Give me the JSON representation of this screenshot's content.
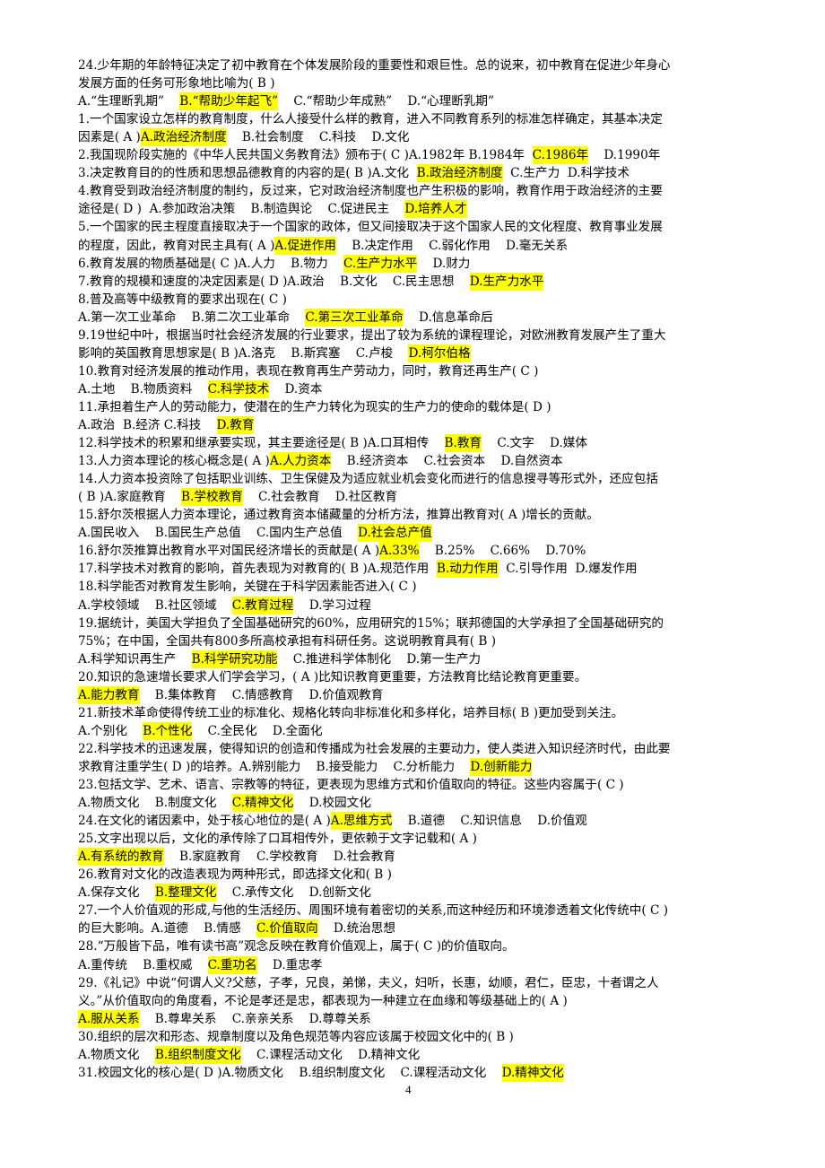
{
  "document": {
    "page_number": "4",
    "highlight_color": "#ffff00",
    "lines": [
      [
        {
          "t": "24.少年期的年龄特征决定了初中教育在个体发展阶段的重要性和艰巨性。总的说来，初中教育在促进少年身心"
        }
      ],
      [
        {
          "t": "发展方面的任务可形象地比喻为( B )"
        }
      ],
      [
        {
          "t": "A.“生理断乳期”    "
        },
        {
          "t": "B.“帮助少年起飞”",
          "h": true
        },
        {
          "t": "    C.“帮助少年成熟”    D.“心理断乳期”"
        }
      ],
      [
        {
          "t": "1.一个国家设立怎样的教育制度，什么人接受什么样的教育，进入不同教育系列的标准怎样确定，其基本决定"
        }
      ],
      [
        {
          "t": "因素是( A )"
        },
        {
          "t": "A.政治经济制度",
          "h": true
        },
        {
          "t": "    B.社会制度    C.科技    D.文化"
        }
      ],
      [
        {
          "t": "2.我国现阶段实施的《中华人民共国义务教育法》颁布于( C )A.1982年 B.1984年  "
        },
        {
          "t": "C.1986年",
          "h": true
        },
        {
          "t": "    D.1990年"
        }
      ],
      [
        {
          "t": "3.决定教育目的的性质和思想品德教育的内容的是( B )A.文化  "
        },
        {
          "t": "B.政治经济制度",
          "h": true
        },
        {
          "t": "  C.生产力  D.科学技术"
        }
      ],
      [
        {
          "t": "4.教育受到政治经济制度的制约，反过来，它对政治经济制度也产生积极的影响，教育作用于政治经济的主要"
        }
      ],
      [
        {
          "t": "途径是( D )  A.参加政治决策    B.制造舆论    C.促进民主    "
        },
        {
          "t": "D.培养人才",
          "h": true
        }
      ],
      [
        {
          "t": "5.一个国家的民主程度直接取决于一个国家的政体，但又间接取决于这个国家人民的文化程度、教育事业发展"
        }
      ],
      [
        {
          "t": "的程度，因此，教育对民主具有( A )"
        },
        {
          "t": "A.促进作用",
          "h": true
        },
        {
          "t": "    B.决定作用    C.弱化作用    D.毫无关系"
        }
      ],
      [
        {
          "t": "6.教育发展的物质基础是( C )A.人力    B.物力    "
        },
        {
          "t": "C.生产力水平",
          "h": true
        },
        {
          "t": "    D.财力"
        }
      ],
      [
        {
          "t": "7.教育的规模和速度的决定因素是( D )A.政治    B.文化    C.民主思想    "
        },
        {
          "t": "D.生产力水平",
          "h": true
        }
      ],
      [
        {
          "t": "8.普及高等中级教育的要求出现在( C )"
        }
      ],
      [
        {
          "t": "A.第一次工业革命    B.第二次工业革命    "
        },
        {
          "t": "C.第三次工业革命",
          "h": true
        },
        {
          "t": "    D.信息革命后"
        }
      ],
      [
        {
          "t": "9.19世纪中叶，根据当时社会经济发展的行业要求，提出了较为系统的课程理论，对欧洲教育发展产生了重大"
        }
      ],
      [
        {
          "t": "影响的英国教育思想家是( B )A.洛克    B.斯宾塞    C.卢梭    "
        },
        {
          "t": "D.柯尔伯格",
          "h": true
        }
      ],
      [
        {
          "t": "10.教育对经济发展的推动作用，表现在教育再生产劳动力，同时，教育还再生产( C )"
        }
      ],
      [
        {
          "t": "A.土地    B.物质资料    "
        },
        {
          "t": "C.科学技术",
          "h": true
        },
        {
          "t": "    D.资本"
        }
      ],
      [
        {
          "t": "11.承担着生产人的劳动能力，使潜在的生产力转化为现实的生产力的使命的载体是( D )"
        }
      ],
      [
        {
          "t": "A.政治  B.经济 C.科技    "
        },
        {
          "t": "D.教育",
          "h": true
        }
      ],
      [
        {
          "t": "12.科学技术的积累和继承要实现，其主要途径是( B )A.口耳相传    "
        },
        {
          "t": "B.教育",
          "h": true
        },
        {
          "t": "    C.文字    D.媒体"
        }
      ],
      [
        {
          "t": "13.人力资本理论的核心概念是( A )"
        },
        {
          "t": "A.人力资本",
          "h": true
        },
        {
          "t": "    B.经济资本    C.社会资本    D.自然资本"
        }
      ],
      [
        {
          "t": "14.人力资本投资除了包括职业训练、卫生保健及为适应就业机会变化而进行的信息搜寻等形式外，还应包括"
        }
      ],
      [
        {
          "t": "( B )A.家庭教育    "
        },
        {
          "t": "B.学校教育",
          "h": true
        },
        {
          "t": "    C.社会教育    D.社区教育"
        }
      ],
      [
        {
          "t": "15.舒尔茨根据人力资本理论，通过教育资本储藏量的分析方法，推算出教育对( A )增长的贡献。"
        }
      ],
      [
        {
          "t": "A.国民收入    B.国民生产总值    C.国内生产总值    "
        },
        {
          "t": "D.社会总产值",
          "h": true
        }
      ],
      [
        {
          "t": "16.舒尔茨推算出教育水平对国民经济增长的贡献是( A )"
        },
        {
          "t": "A.33%",
          "h": true
        },
        {
          "t": "    B.25%    C.66%    D.70%"
        }
      ],
      [
        {
          "t": "17.科学技术对教育的影响，首先表现为对教育的( B )A.规范作用  "
        },
        {
          "t": "B.动力作用",
          "h": true
        },
        {
          "t": "  C.引导作用  D.爆发作用"
        }
      ],
      [
        {
          "t": "18.科学能否对教育发生影响，关键在于科学因素能否进入( C )"
        }
      ],
      [
        {
          "t": "A.学校领域    B.社区领域    "
        },
        {
          "t": "C.教育过程",
          "h": true
        },
        {
          "t": "    D.学习过程"
        }
      ],
      [
        {
          "t": "19.据统计，美国大学担负了全国基础研究的60%，应用研究的15%；联邦德国的大学承担了全国基础研究的"
        }
      ],
      [
        {
          "t": "75%；在中国，全国共有800多所高校承担有科研任务。这说明教育具有( B )"
        }
      ],
      [
        {
          "t": "A.科学知识再生产    "
        },
        {
          "t": "B.科学研究功能",
          "h": true
        },
        {
          "t": "    C.推进科学体制化    D.第一生产力"
        }
      ],
      [
        {
          "t": "20.知识的急速增长要求人们学会学习，( A )比知识教育更重要，方法教育比结论教育更重要。"
        }
      ],
      [
        {
          "t": "A.能力教育",
          "h": true
        },
        {
          "t": "    B.集体教育    C.情感教育    D.价值观教育"
        }
      ],
      [
        {
          "t": "21.新技术革命使得传统工业的标准化、规格化转向非标准化和多样化，培养目标( B )更加受到关注。"
        }
      ],
      [
        {
          "t": "A.个别化    "
        },
        {
          "t": "B.个性化",
          "h": true
        },
        {
          "t": "    C.全民化    D.全面化"
        }
      ],
      [
        {
          "t": "22.科学技术的迅速发展，使得知识的创造和传播成为社会发展的主要动力，使人类进入知识经济时代，由此要"
        }
      ],
      [
        {
          "t": "求教育注重学生( D )的培养。A.辨别能力    B.接受能力    C.分析能力    "
        },
        {
          "t": "D.创新能力",
          "h": true
        }
      ],
      [
        {
          "t": "23.包括文学、艺术、语言、宗教等的特征，更表现为思维方式和价值取向的特征。这些内容属于( C )"
        }
      ],
      [
        {
          "t": "A.物质文化    B.制度文化    "
        },
        {
          "t": "C.精神文化",
          "h": true
        },
        {
          "t": "    D.校园文化"
        }
      ],
      [
        {
          "t": "24.在文化的诸因素中，处于核心地位的是( A )"
        },
        {
          "t": "A.思维方式",
          "h": true
        },
        {
          "t": "    B.道德    C.知识信息    D.价值观"
        }
      ],
      [
        {
          "t": "25.文字出现以后，文化的承传除了口耳相传外，更依赖于文字记载和( A )"
        }
      ],
      [
        {
          "t": "A.有系统的教育",
          "h": true
        },
        {
          "t": "    B.家庭教育    C.学校教育    D.社会教育"
        }
      ],
      [
        {
          "t": "26.教育对文化的改造表现为两种形式，即选择文化和( B )"
        }
      ],
      [
        {
          "t": "A.保存文化    "
        },
        {
          "t": "B.整理文化",
          "h": true
        },
        {
          "t": "    C.承传文化    D.创新文化"
        }
      ],
      [
        {
          "t": "27.一个人价值观的形成,与他的生活经历、周围环境有着密切的关系,而这种经历和环境渗透着文化传统中( C )"
        }
      ],
      [
        {
          "t": "的巨大影响。A.道德    B.情感    "
        },
        {
          "t": "C.价值取向",
          "h": true
        },
        {
          "t": "    D.统治思想"
        }
      ],
      [
        {
          "t": "28.“万般皆下品，唯有读书高”观念反映在教育价值观上，属于( C )的价值取向。"
        }
      ],
      [
        {
          "t": "A.重传统    B.重权威    "
        },
        {
          "t": "C.重功名",
          "h": true
        },
        {
          "t": "    D.重忠孝"
        }
      ],
      [
        {
          "t": "29.《礼记》中说“何谓人义?父慈，子孝，兄良，弟悌，夫义，妇听，长惠，幼顺，君仁，臣忠，十者谓之人"
        }
      ],
      [
        {
          "t": "义。”从价值取向的角度看，不论是孝还是忠，都表现为一种建立在血缘和等级基础上的( A )"
        }
      ],
      [
        {
          "t": "A.服从关系",
          "h": true
        },
        {
          "t": "    B.尊卑关系    C.亲亲关系    D.尊尊关系"
        }
      ],
      [
        {
          "t": "30.组织的层次和形态、规章制度以及角色规范等内容应该属于校园文化中的( B )"
        }
      ],
      [
        {
          "t": "A.物质文化    "
        },
        {
          "t": "B.组织制度文化",
          "h": true
        },
        {
          "t": "    C.课程活动文化    D.精神文化"
        }
      ],
      [
        {
          "t": "31.校园文化的核心是( D )A.物质文化    B.组织制度文化    C.课程活动文化    "
        },
        {
          "t": "D.精神文化",
          "h": true
        }
      ]
    ]
  }
}
